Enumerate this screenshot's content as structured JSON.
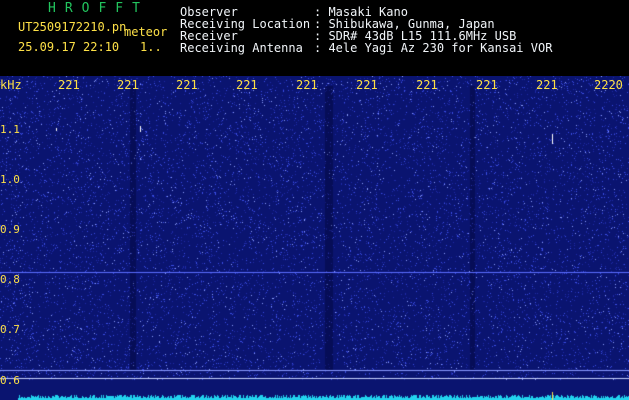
{
  "header": {
    "brand": "HROFFT",
    "filename": "UT2509172210.pn",
    "mode": "meteor",
    "datetime": "25.09.17 22:10",
    "count": "1..",
    "info": [
      {
        "key": "Observer",
        "value": ": Masaki Kano"
      },
      {
        "key": "Receiving Location",
        "value": ": Shibukawa, Gunma, Japan"
      },
      {
        "key": "Receiver",
        "value": ": SDR# 43dB L15 111.6MHz USB"
      },
      {
        "key": "Receiving Antenna",
        "value": ": 4ele Yagi Az 230 for Kansai VOR"
      }
    ]
  },
  "spectrogram": {
    "unit_label": "kHz",
    "y_ticks": [
      "1.1",
      "1.0",
      "0.9",
      "0.8",
      "0.7",
      "0.6"
    ],
    "x_ticks": [
      "221",
      "221",
      "221",
      "221",
      "221",
      "221",
      "221",
      "221",
      "221",
      "2220"
    ],
    "colors": {
      "background": "#0a1470",
      "speckle": "#4a5cff",
      "label": "#fde047",
      "trace": "#22d3ee"
    }
  }
}
